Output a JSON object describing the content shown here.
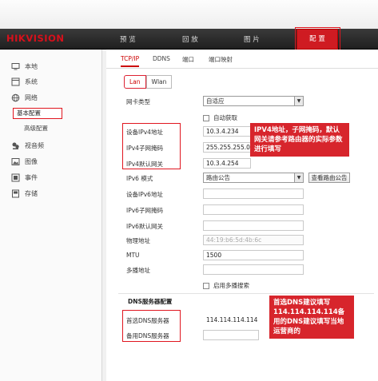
{
  "header": {
    "logo_part1": "HIK",
    "logo_part2": "VISION",
    "nav": [
      "预 览",
      "回 放",
      "图 片",
      "配 置"
    ],
    "active_nav": "配 置"
  },
  "sidebar": {
    "items": [
      {
        "label": "本地",
        "icon": "monitor-icon"
      },
      {
        "label": "系统",
        "icon": "window-icon"
      },
      {
        "label": "网络",
        "icon": "globe-icon"
      },
      {
        "label": "视音频",
        "icon": "camera-icon"
      },
      {
        "label": "图像",
        "icon": "image-icon"
      },
      {
        "label": "事件",
        "icon": "event-icon"
      },
      {
        "label": "存储",
        "icon": "disk-icon"
      }
    ],
    "network_sub": [
      "基本配置",
      "高级配置"
    ],
    "active_sub": "基本配置"
  },
  "tabs": [
    "TCP/IP",
    "DDNS",
    "端口",
    "端口映射"
  ],
  "subtabs": [
    "Lan",
    "Wlan"
  ],
  "form": {
    "nic_type_label": "网卡类型",
    "nic_type_value": "自适应",
    "auto_obtain_label": "自动获取",
    "ipv4_addr_label": "设备IPv4地址",
    "ipv4_addr_value": "10.3.4.234",
    "ipv4_mask_label": "IPv4子网掩码",
    "ipv4_mask_value": "255.255.255.0",
    "ipv4_gw_label": "IPv4默认网关",
    "ipv4_gw_value": "10.3.4.254",
    "ipv6_mode_label": "IPv6 模式",
    "ipv6_mode_value": "路由公告",
    "view_route_button": "查看路由公告",
    "ipv6_addr_label": "设备IPv6地址",
    "ipv6_addr_value": "",
    "ipv6_mask_label": "IPv6子网掩码",
    "ipv6_mask_value": "",
    "ipv6_gw_label": "IPv6默认网关",
    "ipv6_gw_value": "",
    "mac_label": "物理地址",
    "mac_value": "44:19:b6:5d:4b:6c",
    "mtu_label": "MTU",
    "mtu_value": "1500",
    "multicast_label": "多播地址",
    "multicast_value": "",
    "enable_multicast_label": "启用多播搜索",
    "dns_section": "DNS服务器配置",
    "dns1_label": "首选DNS服务器",
    "dns1_value": "114.114.114.114",
    "dns2_label": "备用DNS服务器",
    "dns2_value": ""
  },
  "annotations": {
    "callout1": "IPV4地址，子网掩码，默认网关请参考路由器的实际参数进行填写",
    "callout2": "首选DNS建议填写114.114.114.114备用的DNS建议填写当地运营商的"
  },
  "colors": {
    "accent": "#cf1b22",
    "annotation": "#e0161f"
  }
}
